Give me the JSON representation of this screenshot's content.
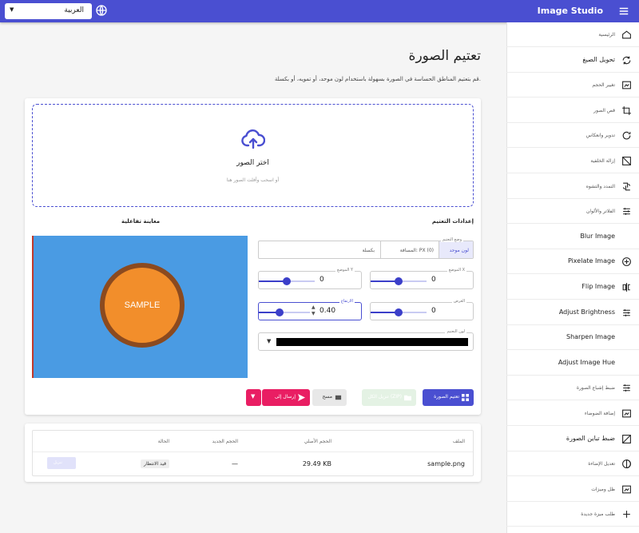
{
  "topbar": {
    "app_title": "Image Studio",
    "language": "العربية",
    "globe_icon": "globe-icon",
    "menu_icon": "hamburger-menu-icon"
  },
  "sidebar": {
    "items": [
      {
        "label": "الرئيسية",
        "icon": "home-icon",
        "faint": true
      },
      {
        "label": "تحويل الصيغ",
        "icon": "convert-icon",
        "faint": false
      },
      {
        "label": "تغيير الحجم",
        "icon": "resize-icon",
        "faint": true
      },
      {
        "label": "قص الصور",
        "icon": "crop-icon",
        "faint": true
      },
      {
        "label": "تدوير وانعكاس",
        "icon": "rotate-icon",
        "faint": true
      },
      {
        "label": "إزالة الخلفية",
        "icon": "remove-bg-icon",
        "faint": true
      },
      {
        "label": "التمدد والتشوه",
        "icon": "transform-icon",
        "faint": true
      },
      {
        "label": "الفلاتر والألوان",
        "icon": "filters-icon",
        "faint": true
      },
      {
        "label": "Blur Image",
        "icon": "blur-icon",
        "faint": false
      },
      {
        "label": "Pixelate Image",
        "icon": "pixelate-icon",
        "faint": false
      },
      {
        "label": "Flip Image",
        "icon": "flip-icon",
        "faint": false
      },
      {
        "label": "Adjust Brightness",
        "icon": "brightness-icon",
        "faint": false
      },
      {
        "label": "Sharpen Image",
        "icon": "sharpen-icon",
        "faint": false
      },
      {
        "label": "Adjust Image Hue",
        "icon": "hue-icon",
        "faint": false
      },
      {
        "label": "ضبط إشباع الصورة",
        "icon": "saturation-icon",
        "faint": true
      },
      {
        "label": "إضافة الضوضاء",
        "icon": "noise-icon",
        "faint": true
      },
      {
        "label": "ضبط تباين الصورة",
        "icon": "contrast-icon",
        "faint": false
      },
      {
        "label": "تعديل الإضاءة",
        "icon": "exposure-icon",
        "faint": true
      },
      {
        "label": "ظل وميزات",
        "icon": "shadow-icon",
        "faint": true
      },
      {
        "label": "طلب ميزة جديدة",
        "icon": "plus-icon",
        "faint": true
      }
    ]
  },
  "main": {
    "title": "تعتيم الصورة",
    "description": "قم بتعتيم المناطق الحساسة في الصورة بسهولة باستخدام لون موحد، أو تمويه، أو بكسلة."
  },
  "dropzone": {
    "title": "اختر الصور",
    "hint": "أو اسحب وأفلت الصور هنا",
    "icon": "cloud-upload-icon"
  },
  "settings": {
    "heading": "إعدادات التعتيم",
    "mode_legend": "وضع التعتيم",
    "mode_solid": "لون موحد",
    "mode_blur": "المسافة: PX (0)",
    "mode_pixelate": "بكسلة",
    "x_label": "الموضع X",
    "x_value": "0",
    "x_level": 0.5,
    "y_label": "الموضع Y",
    "y_value": "0",
    "y_level": 0.5,
    "width_label": "العرض",
    "width_value": "0",
    "width_level": 0.5,
    "height_label": "الارتفاع",
    "height_value": "0.40",
    "height_level": 0.4,
    "color_label": "لون التعتيم",
    "color_value": "#000000"
  },
  "preview": {
    "heading": "معاينة تفاعلية",
    "sample_text": "SAMPLE",
    "bg_color": "#4a9be3",
    "circle_color": "#f28e2b",
    "ring_color": "#8b4a1f"
  },
  "actions": {
    "apply_label": "تعتيم الصورة",
    "download_all_label": "تنزيل الكل (ZIP)",
    "clear_label": "مسح",
    "send_label": "إرسال إلى",
    "apply_icon": "grid-icon",
    "download_icon": "folder-icon",
    "clear_icon": "erase-icon",
    "send_icon": "send-icon",
    "dropdown_icon": "caret-down-icon"
  },
  "files_table": {
    "headers": {
      "name": "الملف",
      "original_size": "الحجم الأصلي",
      "new_size": "الحجم الجديد",
      "status": "الحالة"
    },
    "rows": [
      {
        "name": "sample.png",
        "original_size": "29.49 KB",
        "new_size": "—",
        "status": "قيد الانتظار",
        "action": "تنزيل"
      }
    ]
  }
}
